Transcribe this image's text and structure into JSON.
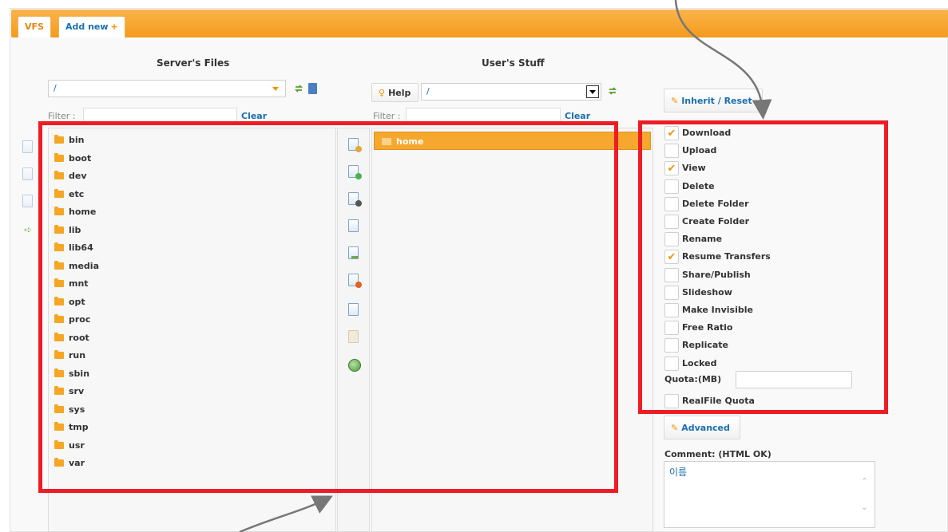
{
  "tabs": [
    {
      "label": "VFS",
      "active": true
    },
    {
      "label": "Add new",
      "icon": "plus-icon",
      "suffix": "+"
    }
  ],
  "server": {
    "title": "Server's Files",
    "path": "/",
    "filter_label": "Filter :",
    "clear_label": "Clear",
    "folders": [
      "bin",
      "boot",
      "dev",
      "etc",
      "home",
      "lib",
      "lib64",
      "media",
      "mnt",
      "opt",
      "proc",
      "root",
      "run",
      "sbin",
      "srv",
      "sys",
      "tmp",
      "usr",
      "var"
    ]
  },
  "user": {
    "title": "User's Stuff",
    "help_label": "Help",
    "path": "/",
    "filter_label": "Filter :",
    "clear_label": "Clear",
    "folders": [
      "home"
    ],
    "selected": "home"
  },
  "permissions": {
    "inherit_label": "Inherit / Reset",
    "items": [
      {
        "label": "Download",
        "checked": true
      },
      {
        "label": "Upload",
        "checked": false
      },
      {
        "label": "View",
        "checked": true
      },
      {
        "label": "Delete",
        "checked": false
      },
      {
        "label": "Delete Folder",
        "checked": false
      },
      {
        "label": "Create Folder",
        "checked": false
      },
      {
        "label": "Rename",
        "checked": false
      },
      {
        "label": "Resume Transfers",
        "checked": true
      },
      {
        "label": "Share/Publish",
        "checked": false
      },
      {
        "label": "Slideshow",
        "checked": false
      },
      {
        "label": "Make Invisible",
        "checked": false
      },
      {
        "label": "Free Ratio",
        "checked": false
      },
      {
        "label": "Replicate",
        "checked": false
      },
      {
        "label": "Locked",
        "checked": false
      }
    ],
    "quota_label": "Quota:(MB)",
    "quota_value": "",
    "realfile_quota": {
      "label": "RealFile Quota",
      "checked": false
    },
    "advanced_label": "Advanced",
    "comment_label": "Comment: (HTML OK)",
    "comment_value": "이름"
  },
  "colors": {
    "accent_orange": "#f39b1d",
    "link_blue": "#1a6fae",
    "annotation_red": "#ee1c25"
  }
}
